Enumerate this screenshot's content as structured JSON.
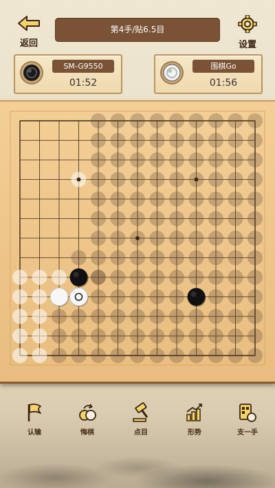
{
  "header": {
    "back_label": "返回",
    "settings_label": "设置",
    "status": "第4手/贴6.5目"
  },
  "players": {
    "black": {
      "name": "SM-G9550",
      "time": "01:52",
      "stone": "black"
    },
    "white": {
      "name": "围棋Go",
      "time": "01:56",
      "stone": "white"
    }
  },
  "board": {
    "size": 13,
    "star_points": [
      [
        3,
        3
      ],
      [
        9,
        3
      ],
      [
        6,
        6
      ]
    ],
    "stones": [
      {
        "col": 3,
        "row": 8,
        "color": "black"
      },
      {
        "col": 2,
        "row": 9,
        "color": "white"
      },
      {
        "col": 3,
        "row": 9,
        "color": "white",
        "last_move": true
      },
      {
        "col": 9,
        "row": 9,
        "color": "black"
      }
    ],
    "territory_black": [
      [
        4,
        0
      ],
      [
        4,
        1
      ],
      [
        4,
        2
      ],
      [
        4,
        3
      ],
      [
        4,
        4
      ],
      [
        4,
        5
      ],
      [
        4,
        6
      ],
      [
        4,
        7
      ],
      [
        4,
        8
      ],
      [
        4,
        9
      ],
      [
        4,
        10
      ],
      [
        4,
        11
      ],
      [
        4,
        12
      ],
      [
        5,
        0
      ],
      [
        5,
        1
      ],
      [
        5,
        2
      ],
      [
        5,
        3
      ],
      [
        5,
        4
      ],
      [
        5,
        5
      ],
      [
        5,
        6
      ],
      [
        5,
        7
      ],
      [
        5,
        8
      ],
      [
        5,
        9
      ],
      [
        5,
        10
      ],
      [
        5,
        11
      ],
      [
        5,
        12
      ],
      [
        6,
        0
      ],
      [
        6,
        1
      ],
      [
        6,
        2
      ],
      [
        6,
        3
      ],
      [
        6,
        4
      ],
      [
        6,
        5
      ],
      [
        6,
        6
      ],
      [
        6,
        7
      ],
      [
        6,
        8
      ],
      [
        6,
        9
      ],
      [
        6,
        10
      ],
      [
        6,
        11
      ],
      [
        6,
        12
      ],
      [
        7,
        0
      ],
      [
        7,
        1
      ],
      [
        7,
        2
      ],
      [
        7,
        3
      ],
      [
        7,
        4
      ],
      [
        7,
        5
      ],
      [
        7,
        6
      ],
      [
        7,
        7
      ],
      [
        7,
        8
      ],
      [
        7,
        9
      ],
      [
        7,
        10
      ],
      [
        7,
        11
      ],
      [
        7,
        12
      ],
      [
        8,
        0
      ],
      [
        8,
        1
      ],
      [
        8,
        2
      ],
      [
        8,
        3
      ],
      [
        8,
        4
      ],
      [
        8,
        5
      ],
      [
        8,
        6
      ],
      [
        8,
        7
      ],
      [
        8,
        8
      ],
      [
        8,
        9
      ],
      [
        8,
        10
      ],
      [
        8,
        11
      ],
      [
        8,
        12
      ],
      [
        9,
        0
      ],
      [
        9,
        1
      ],
      [
        9,
        2
      ],
      [
        9,
        3
      ],
      [
        9,
        4
      ],
      [
        9,
        5
      ],
      [
        9,
        6
      ],
      [
        9,
        7
      ],
      [
        9,
        8
      ],
      [
        9,
        10
      ],
      [
        9,
        11
      ],
      [
        9,
        12
      ],
      [
        10,
        0
      ],
      [
        10,
        1
      ],
      [
        10,
        2
      ],
      [
        10,
        3
      ],
      [
        10,
        4
      ],
      [
        10,
        5
      ],
      [
        10,
        6
      ],
      [
        10,
        7
      ],
      [
        10,
        8
      ],
      [
        10,
        9
      ],
      [
        10,
        10
      ],
      [
        10,
        11
      ],
      [
        10,
        12
      ],
      [
        11,
        0
      ],
      [
        11,
        1
      ],
      [
        11,
        2
      ],
      [
        11,
        3
      ],
      [
        11,
        4
      ],
      [
        11,
        5
      ],
      [
        11,
        6
      ],
      [
        11,
        7
      ],
      [
        11,
        8
      ],
      [
        11,
        9
      ],
      [
        11,
        10
      ],
      [
        11,
        11
      ],
      [
        11,
        12
      ],
      [
        12,
        0
      ],
      [
        12,
        1
      ],
      [
        12,
        2
      ],
      [
        12,
        3
      ],
      [
        12,
        4
      ],
      [
        12,
        5
      ],
      [
        12,
        6
      ],
      [
        12,
        7
      ],
      [
        12,
        8
      ],
      [
        12,
        9
      ],
      [
        12,
        10
      ],
      [
        12,
        11
      ],
      [
        12,
        12
      ],
      [
        3,
        10
      ],
      [
        3,
        11
      ],
      [
        3,
        12
      ],
      [
        2,
        12
      ],
      [
        2,
        11
      ],
      [
        2,
        10
      ],
      [
        3,
        7
      ],
      [
        4,
        8
      ]
    ],
    "territory_white": [
      [
        0,
        8
      ],
      [
        1,
        8
      ],
      [
        0,
        9
      ],
      [
        1,
        9
      ],
      [
        0,
        10
      ],
      [
        1,
        10
      ],
      [
        0,
        11
      ],
      [
        1,
        11
      ],
      [
        0,
        12
      ],
      [
        1,
        12
      ],
      [
        2,
        8
      ],
      [
        3,
        3
      ]
    ]
  },
  "actions": [
    {
      "id": "resign",
      "label": "认输",
      "icon": "flag-icon"
    },
    {
      "id": "undo",
      "label": "悔棋",
      "icon": "undo-stones-icon"
    },
    {
      "id": "count",
      "label": "点目",
      "icon": "gavel-icon"
    },
    {
      "id": "situation",
      "label": "形势",
      "icon": "chart-icon"
    },
    {
      "id": "hint",
      "label": "支一手",
      "icon": "hint-icon"
    }
  ]
}
